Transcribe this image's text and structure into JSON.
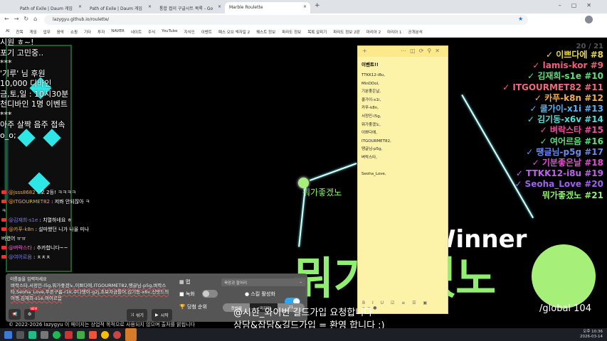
{
  "browser": {
    "tabs": [
      {
        "title": "Path of Exile | Daum 게임"
      },
      {
        "title": "Path of Exile | Daum 게임"
      },
      {
        "title": "통합 접이 구글시트 목록 - Go"
      },
      {
        "title": "Marble Roulette"
      }
    ],
    "url": "lazygyu.github.io/roulette/",
    "bookmarks": [
      "AI",
      "친목",
      "게임",
      "업무",
      "음악",
      "쇼핑",
      "기타",
      "투자",
      "NAVER",
      "네이트",
      "주식",
      "YouTube",
      "지식인",
      "이벤트",
      "패스 오브 엑자일 2",
      "퀘스트 정보",
      "파라도 정보",
      "목록 살피기",
      "파라도 정보 2판",
      "마리아 2",
      "마리아 1",
      "공개분석"
    ]
  },
  "overlay": {
    "announcement": "시원 ㅎ~!\n포기 고민중..\n***\n'기루' 님 후원\n10,000 디바인\n금,토,일 : 10시30분\n천디바인 1명 이벤트\n***\n아주 살짝 음주 접속\no_o;"
  },
  "chat": [
    {
      "user": "@jsss8682",
      "msg": " : 오 2등! ㅋㅋㅋㅋ",
      "cls": "u"
    },
    {
      "user": "@ITGOURMET82",
      "msg": " : 저쫘 안되잖아 ㅋㅋ",
      "cls": "u"
    },
    {
      "user": "@김재희-s1e",
      "msg": " : 치열하네요 ㅎ",
      "cls": "u2"
    },
    {
      "user": "@카푸-k8n",
      "msg": " : 설마했던 니가 나올 미나버렸어 ㅠㅠ",
      "cls": "u"
    },
    {
      "user": "@벼락스타",
      "msg": " : 추카합니다~~",
      "cls": "u3"
    },
    {
      "user": "@여어르음",
      "msg": " : ㅊㅊㅊ",
      "cls": "u2"
    }
  ],
  "ranking": {
    "count": "20 / 21",
    "items": [
      {
        "text": "✓ 이쁘다에 #8",
        "color": "#e8d84a"
      },
      {
        "text": "✓ lamis-kor #9",
        "color": "#f0607a"
      },
      {
        "text": "✓ 김재희-s1e #10",
        "color": "#5de07a"
      },
      {
        "text": "✓ ITGOURMET82 #11",
        "color": "#f06a7a"
      },
      {
        "text": "✓ 카푸-k8n #12",
        "color": "#f0b050"
      },
      {
        "text": "✓ 쿨가이-x1i #13",
        "color": "#5ab0f0"
      },
      {
        "text": "✓ 김기동-x6v #14",
        "color": "#4ae0d8"
      },
      {
        "text": "✓ 벼락스타 #15",
        "color": "#f050a0"
      },
      {
        "text": "✓ 여어르음 #16",
        "color": "#5de07a"
      },
      {
        "text": "✓ 땡글님-p5g #17",
        "color": "#6a8af0"
      },
      {
        "text": "✓ 기분좋은날 #18",
        "color": "#e050d0"
      },
      {
        "text": "✓ TTKK12-i8u #19",
        "color": "#c060f0"
      },
      {
        "text": "✓ Seoha_Love #20",
        "color": "#a060f0"
      },
      {
        "text": "뭐가좋겠노 #21",
        "color": "#90ee70"
      }
    ]
  },
  "note": {
    "title": "이벤트!!",
    "body": "TTKK12-i8u,\nMinDDol,\n기분좋은날,\n쿨가이-x1i,\n카푸-k8n,\n서정민-l5g,\n뭐가좋겠노,\n이쁘다에,\nITGOURMET82,\n땡글님-p5g,\n벼락스타,\n\nSeoha_Love,",
    "toolbar": "B I U ☑ ≡ ☰ ▣ ──●"
  },
  "game": {
    "winner_label": "Winner",
    "winner_name": "뭐가좋겠노",
    "marble_label": "뭐가좋겠노",
    "global": "/global 104",
    "accent": "#90ee70"
  },
  "panel": {
    "names_label": "이름들을 입력하세요",
    "names_value": "벼락스타,서정민-l5g,뭐가좋겠노,이쁘다에,ITGOURMET82,땡글님-p5g,벼락스타,Seoha_Love,푸른구름-r1k,수다쟁이-g2j,초보자금틀어,김기동-x6v,신밧드의여행,김재희-s1e,여어르음",
    "map_label": "맵",
    "map_value": "육망과 할머리",
    "record_label": "녹화",
    "skill_label": "스킬 활성화",
    "rank_label": "당첨 순위",
    "seg": [
      "첫번째",
      "✓마지막",
      "21"
    ],
    "shuffle": "섞기",
    "start": "시작",
    "new_badge": "NEW"
  },
  "subtitle": {
    "line1": "@시한_와이번 길드가입 요청합니다",
    "line2": "상담&잡담&길드가입 = 환영 합니다 :)"
  },
  "footer": "© 2022-2026 lazygyu  이 페이지는 상업적 목적으로 사용되지 않으며 출처를 밝힙니다",
  "clock": {
    "time": "오후 10:36",
    "date": "2026-03-14"
  }
}
